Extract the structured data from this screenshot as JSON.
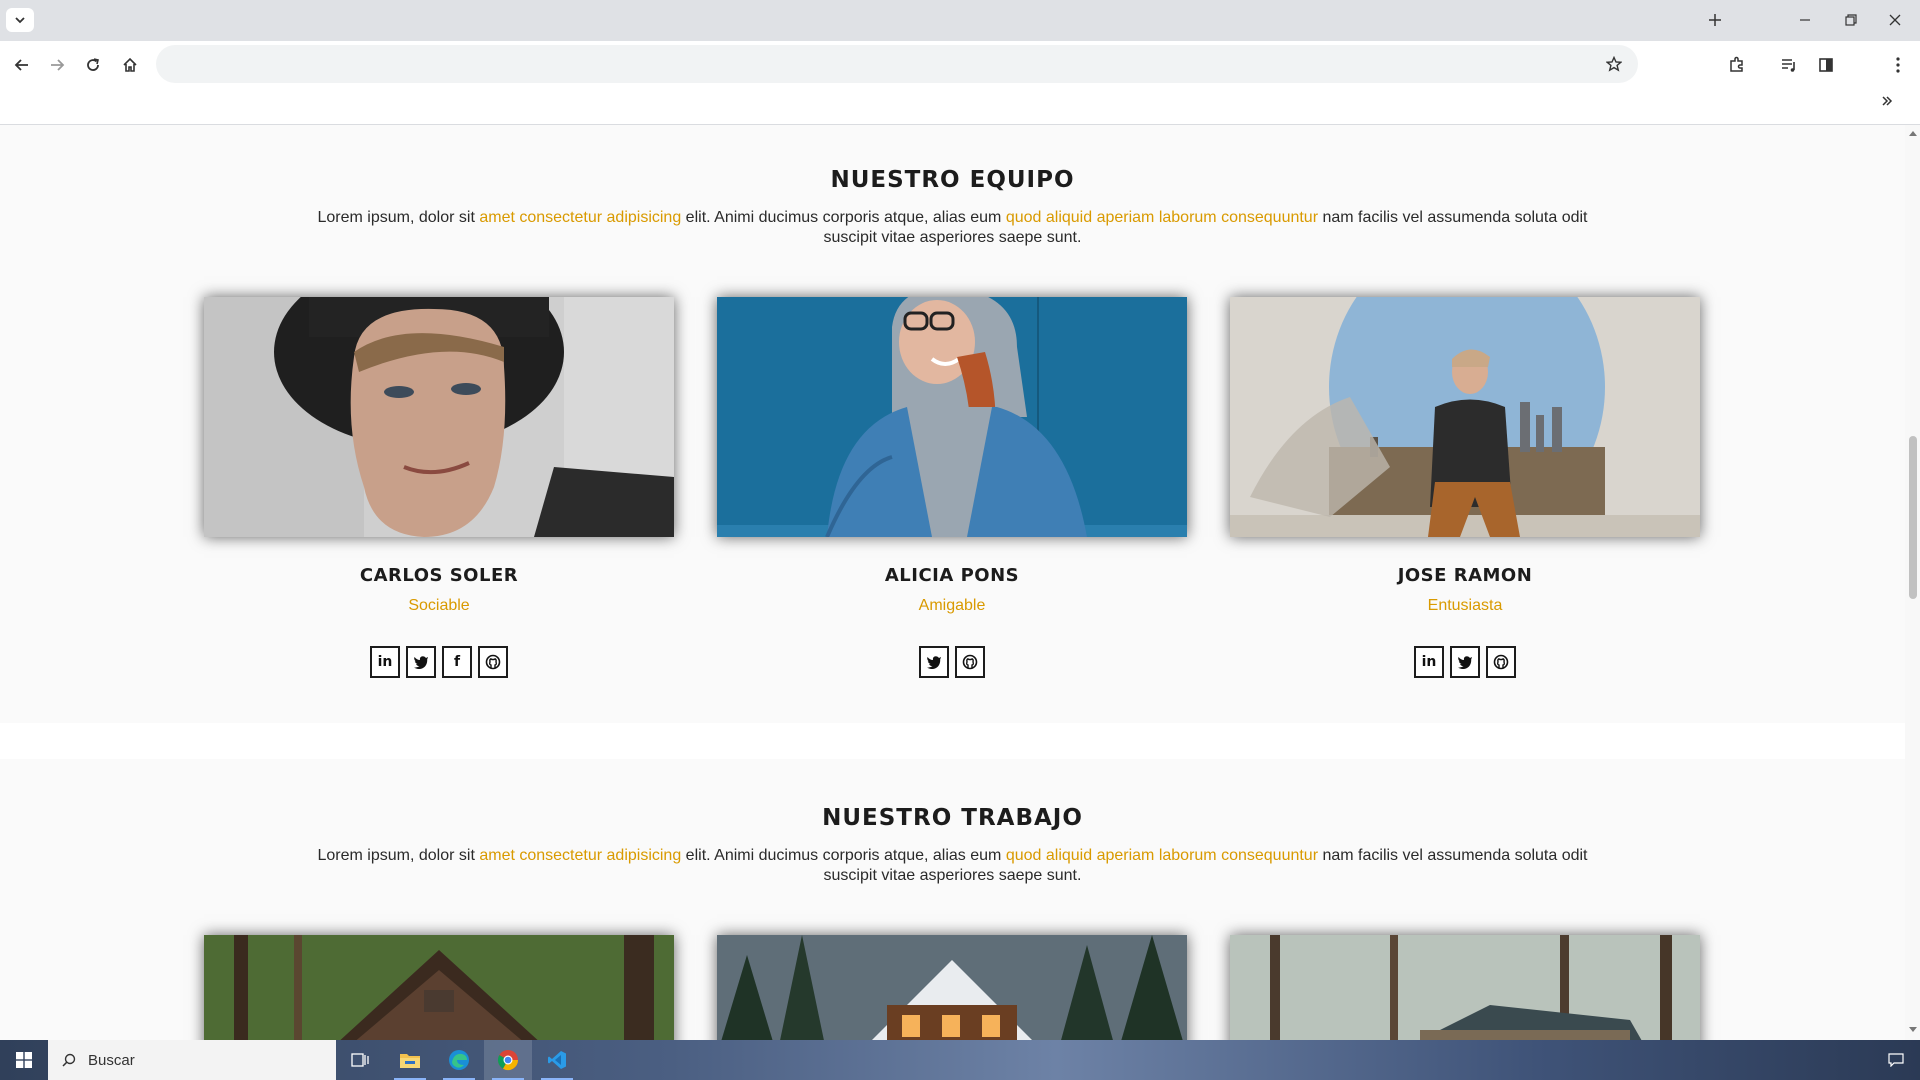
{
  "browser": {
    "omnibox_value": ""
  },
  "team": {
    "title": "NUESTRO EQUIPO",
    "text": {
      "p1": "Lorem ipsum, dolor sit ",
      "h1": "amet consectetur adipisicing",
      "p2": " elit. Animi ducimus corporis atque, alias eum ",
      "h2": "quod aliquid aperiam laborum consequuntur",
      "p3": " nam facilis vel assumenda soluta odit suscipit vitae asperiores saepe sunt."
    },
    "members": [
      {
        "name": "CARLOS SOLER",
        "role": "Sociable",
        "socials": [
          "linkedin",
          "twitter",
          "facebook",
          "github"
        ]
      },
      {
        "name": "ALICIA PONS",
        "role": "Amigable",
        "socials": [
          "twitter",
          "github"
        ]
      },
      {
        "name": "JOSE RAMON",
        "role": "Entusiasta",
        "socials": [
          "linkedin",
          "twitter",
          "github"
        ]
      }
    ]
  },
  "work": {
    "title": "NUESTRO TRABAJO",
    "text": {
      "p1": "Lorem ipsum, dolor sit ",
      "h1": "amet consectetur adipisicing",
      "p2": " elit. Animi ducimus corporis atque, alias eum ",
      "h2": "quod aliquid aperiam laborum consequuntur",
      "p3": " nam facilis vel assumenda soluta odit suscipit vitae asperiores saepe sunt."
    }
  },
  "taskbar": {
    "search_placeholder": "Buscar",
    "apps": [
      "task-view",
      "file-explorer",
      "edge",
      "chrome",
      "vscode"
    ]
  },
  "colors": {
    "accent": "#d99a00",
    "heading": "#1c1c1c"
  }
}
